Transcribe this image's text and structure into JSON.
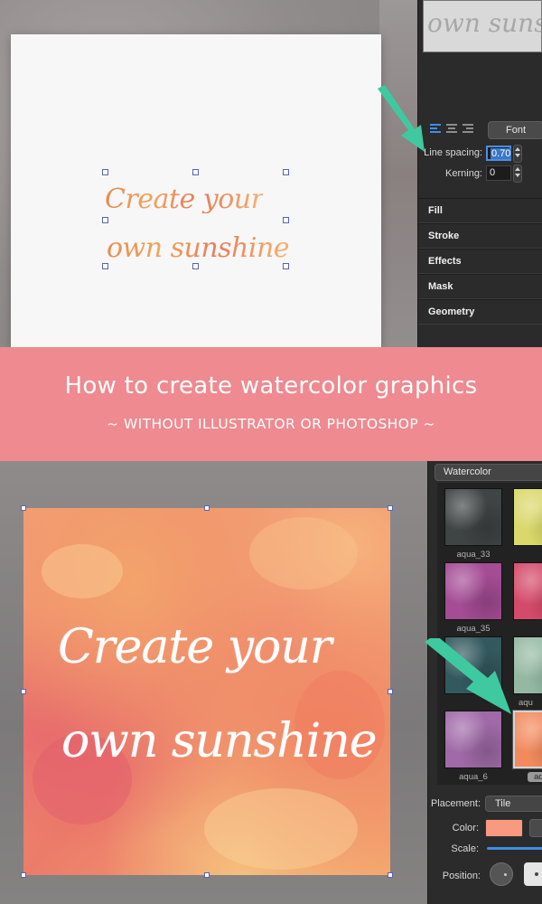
{
  "top_canvas": {
    "line1": "Create your",
    "line2": "own sunshine"
  },
  "preview_thumb_text": "own sunsh",
  "text_panel": {
    "font_button": "Font",
    "line_spacing_label": "Line spacing:",
    "line_spacing_value": "0.70",
    "kerning_label": "Kerning:",
    "kerning_value": "0",
    "sections": [
      "Fill",
      "Stroke",
      "Effects",
      "Mask",
      "Geometry"
    ]
  },
  "banner": {
    "title": "How to create watercolor graphics",
    "subtitle": "~ WITHOUT ILLUSTRATOR OR PHOTOSHOP ~"
  },
  "bottom_canvas": {
    "line1": "Create your",
    "line2": "own sunshine"
  },
  "texture_panel": {
    "category": "Watercolor",
    "tiles": [
      {
        "label": "aqua_33",
        "color": "#3f4444"
      },
      {
        "label": "",
        "color": "#d9d86a"
      },
      {
        "label": "aqua_35",
        "color": "#a54c95"
      },
      {
        "label": "",
        "color": "#d44a6a"
      },
      {
        "label": "",
        "color": "#33595e"
      },
      {
        "label": "aqu",
        "color": "#94b9a3"
      },
      {
        "label": "aqua_6",
        "color": "#a06aa8"
      },
      {
        "label": "aqu",
        "color": "#f28a5e"
      }
    ],
    "placement_label": "Placement:",
    "placement_value": "Tile",
    "color_label": "Color:",
    "color_value": "#f99a80",
    "scale_label": "Scale:",
    "position_label": "Position:"
  },
  "colors": {
    "banner": "#ee8a90",
    "accent": "#3f8ee6",
    "arrow": "#3fc9a0"
  }
}
